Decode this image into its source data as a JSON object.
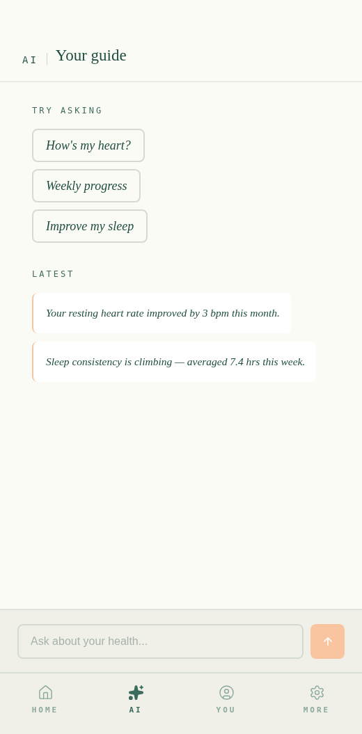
{
  "header": {
    "section": "AI",
    "title": "Your guide"
  },
  "suggestions": {
    "heading": "TRY ASKING",
    "items": [
      "How's my heart?",
      "Weekly progress",
      "Improve my sleep"
    ]
  },
  "latest": {
    "heading": "LATEST",
    "items": [
      "Your resting heart rate improved by 3 bpm this month.",
      "Sleep consistency is climbing — averaged 7.4 hrs this week."
    ]
  },
  "composer": {
    "placeholder": "Ask about your health..."
  },
  "nav": [
    {
      "kind": "home",
      "label": "HOME",
      "selected": false
    },
    {
      "kind": "ai",
      "label": "AI",
      "selected": true
    },
    {
      "kind": "you",
      "label": "YOU",
      "selected": false
    },
    {
      "kind": "more",
      "label": "MORE",
      "selected": false
    }
  ]
}
